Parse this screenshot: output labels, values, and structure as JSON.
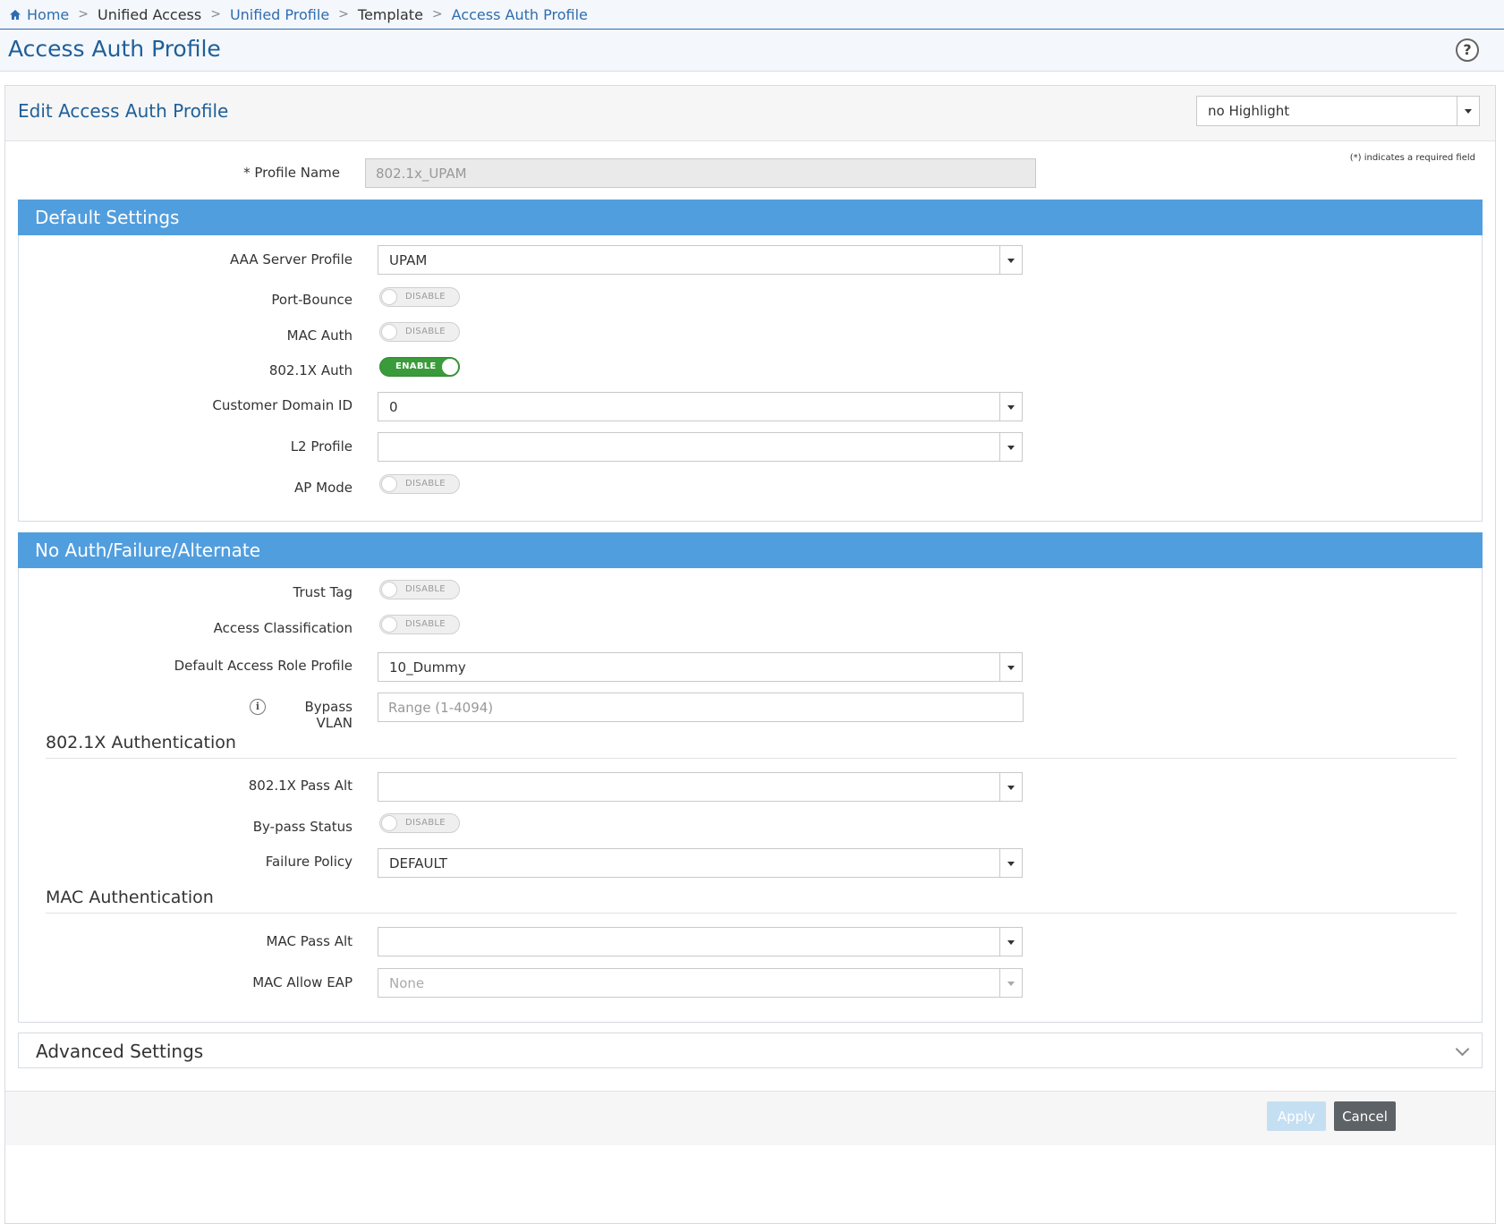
{
  "breadcrumb": {
    "home": "Home",
    "items": [
      "Unified Access",
      "Unified Profile",
      "Template",
      "Access Auth Profile"
    ],
    "separator": ">"
  },
  "page": {
    "title": "Access Auth Profile",
    "help": "?"
  },
  "panel": {
    "title": "Edit Access Auth Profile",
    "highlight_select": "no Highlight",
    "required_note": "(*) indicates a required field"
  },
  "profile_name": {
    "label": "* Profile Name",
    "value": "802.1x_UPAM"
  },
  "default_settings": {
    "title": "Default Settings",
    "aaa_server_profile": {
      "label": "AAA Server Profile",
      "value": "UPAM"
    },
    "port_bounce": {
      "label": "Port-Bounce",
      "state": "DISABLE"
    },
    "mac_auth": {
      "label": "MAC Auth",
      "state": "DISABLE"
    },
    "dot1x_auth": {
      "label": "802.1X Auth",
      "state": "ENABLE"
    },
    "customer_domain_id": {
      "label": "Customer Domain ID",
      "value": "0"
    },
    "l2_profile": {
      "label": "L2 Profile",
      "value": ""
    },
    "ap_mode": {
      "label": "AP Mode",
      "state": "DISABLE"
    }
  },
  "no_auth": {
    "title": "No Auth/Failure/Alternate",
    "trust_tag": {
      "label": "Trust Tag",
      "state": "DISABLE"
    },
    "access_classification": {
      "label": "Access Classification",
      "state": "DISABLE"
    },
    "default_access_role_profile": {
      "label": "Default Access Role Profile",
      "value": "10_Dummy"
    },
    "bypass_vlan": {
      "label": "Bypass VLAN",
      "placeholder": "Range (1-4094)",
      "info": "i"
    },
    "dot1x_section": {
      "title": "802.1X Authentication",
      "pass_alt": {
        "label": "802.1X Pass Alt",
        "value": ""
      },
      "bypass_status": {
        "label": "By-pass Status",
        "state": "DISABLE"
      },
      "failure_policy": {
        "label": "Failure Policy",
        "value": "DEFAULT"
      }
    },
    "mac_section": {
      "title": "MAC Authentication",
      "pass_alt": {
        "label": "MAC Pass Alt",
        "value": ""
      },
      "allow_eap": {
        "label": "MAC Allow EAP",
        "value": "None"
      }
    }
  },
  "advanced_settings": {
    "title": "Advanced Settings"
  },
  "footer": {
    "apply": "Apply",
    "cancel": "Cancel"
  },
  "colors": {
    "accent": "#1f5f99",
    "section_bar": "#519ede",
    "toggle_on": "#3a9b3a",
    "cancel_button": "#5d6266",
    "apply_button_disabled": "#c5dff2"
  }
}
